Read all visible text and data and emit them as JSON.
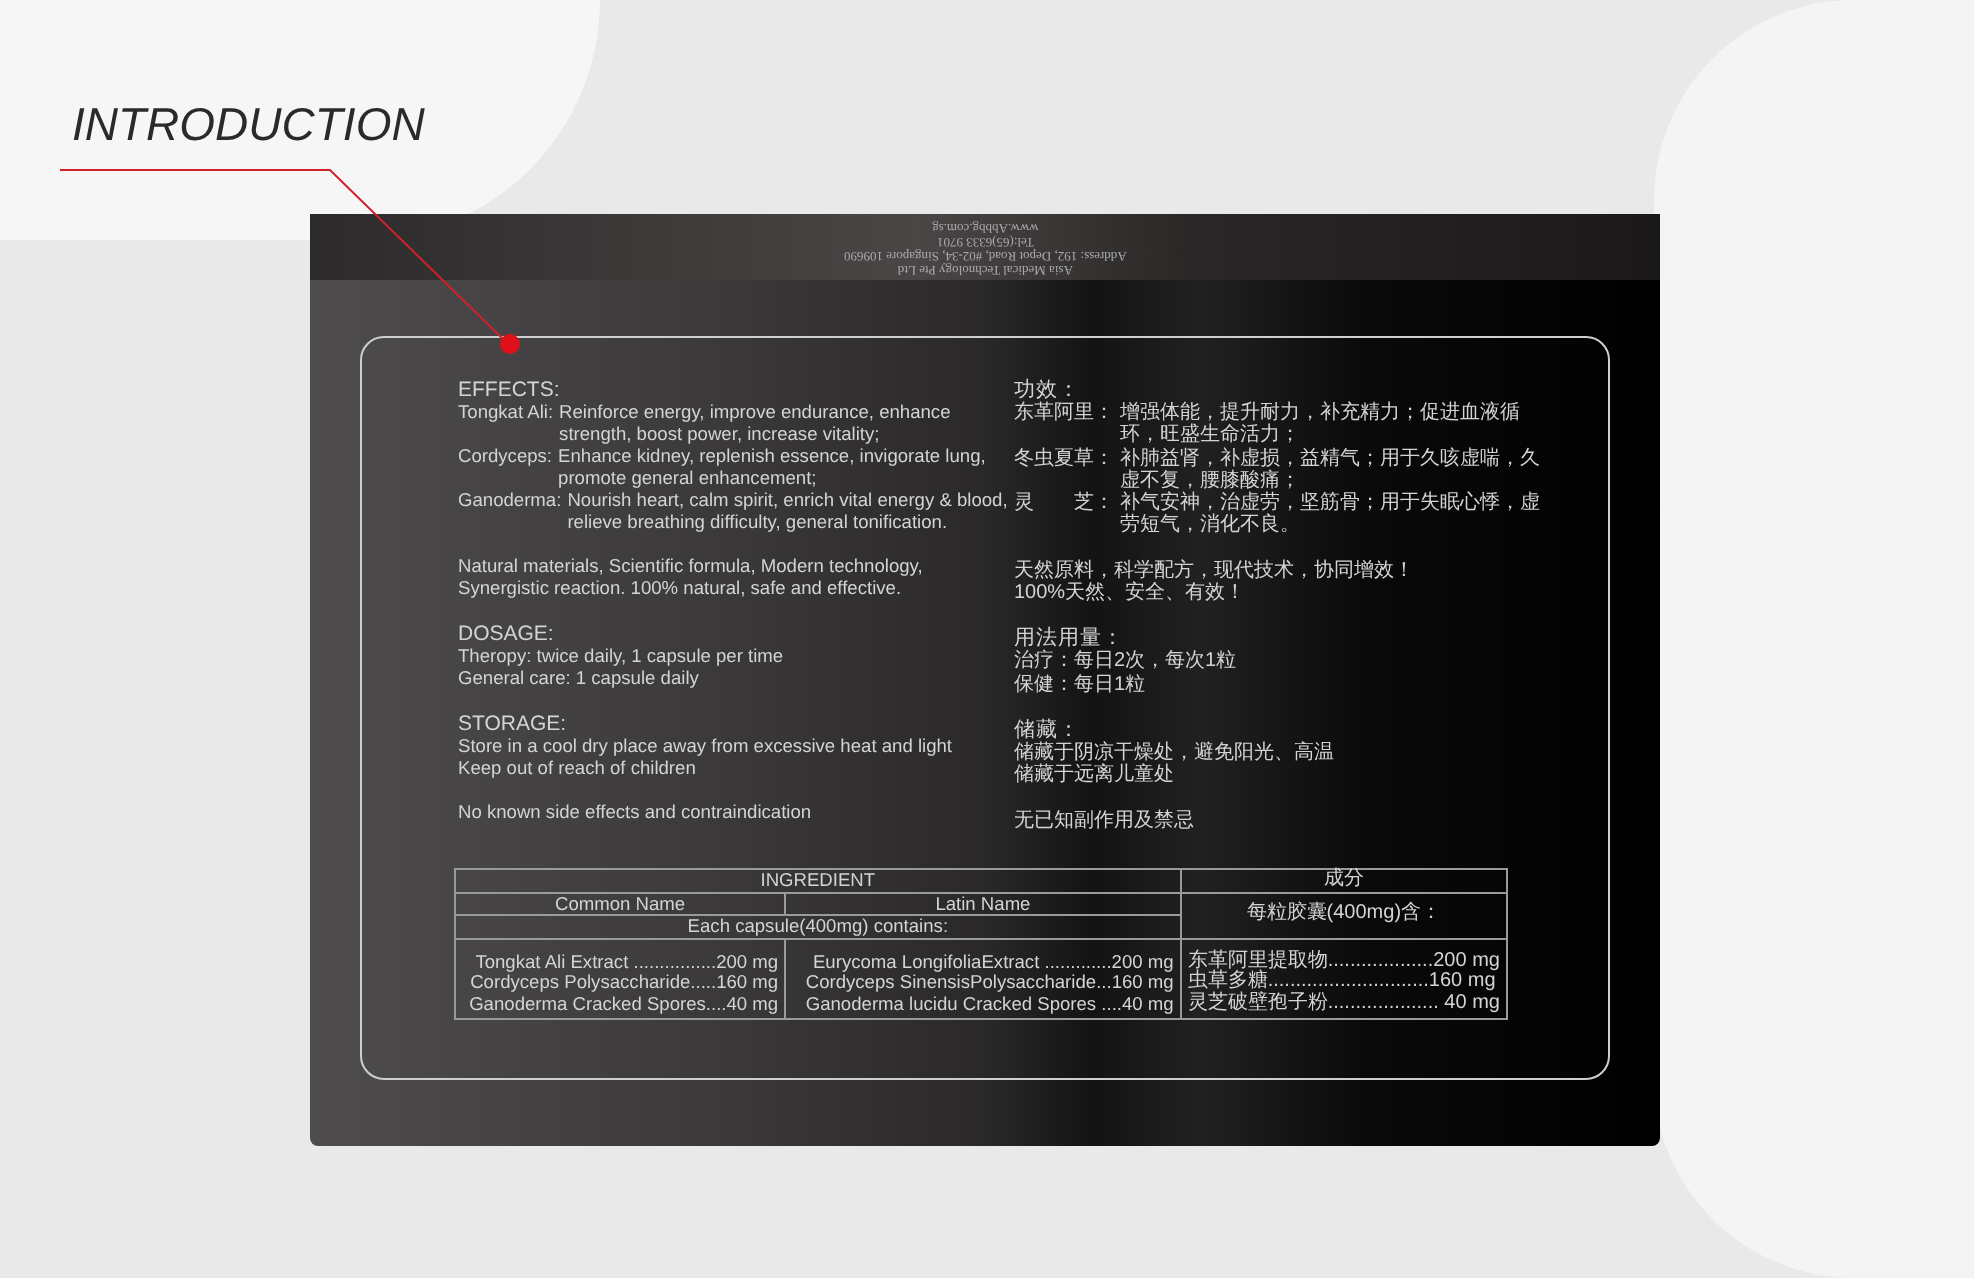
{
  "heading": "INTRODUCTION",
  "box_top_lines": [
    "Asia Medical Technology Pte Ltd",
    "Address: 192, Depot Road, #02-34, Singapore 109690",
    "Tel:(65)6333 9701",
    "www.Abbbg.com.sg"
  ],
  "english": [
    {
      "title": "EFFECTS:",
      "items": [
        {
          "label": "Tongkat Ali:",
          "text": "Reinforce energy, improve endurance, enhance strength, boost power, increase vitality;"
        },
        {
          "label": "Cordyceps:",
          "text": "Enhance kidney, replenish essence, invigorate lung, promote general enhancement;"
        },
        {
          "label": "Ganoderma:",
          "text": "Nourish heart, calm spirit, enrich vital energy & blood, relieve breathing difficulty, general tonification."
        }
      ]
    },
    {
      "lines": [
        "Natural materials, Scientific formula, Modern technology,",
        "Synergistic reaction. 100% natural, safe and effective."
      ]
    },
    {
      "title": "DOSAGE:",
      "lines": [
        "Theropy: twice daily, 1 capsule per time",
        "General care: 1 capsule daily"
      ]
    },
    {
      "title": "STORAGE:",
      "lines": [
        "Store in a cool dry place away from excessive heat and light",
        "Keep out of reach of children"
      ]
    },
    {
      "lines": [
        "No known side effects and contraindication"
      ]
    }
  ],
  "chinese": [
    {
      "title": "功效：",
      "items": [
        {
          "label": "东革阿里：",
          "text": "增强体能，提升耐力，补充精力；促进血液循环，旺盛生命活力；"
        },
        {
          "label": "冬虫夏草：",
          "text": "补肺益肾，补虚损，益精气；用于久咳虚喘，久虚不复，腰膝酸痛；"
        },
        {
          "label": "灵　　芝：",
          "text": "补气安神，治虚劳，坚筋骨；用于失眠心悸，虚劳短气，消化不良。"
        }
      ]
    },
    {
      "lines": [
        "天然原料，科学配方，现代技术，协同增效！",
        "100%天然、安全、有效！"
      ]
    },
    {
      "title": "用法用量：",
      "lines": [
        "治疗：每日2次，每次1粒",
        "保健：每日1粒"
      ]
    },
    {
      "title": "储藏：",
      "lines": [
        "储藏于阴凉干燥处，避免阳光、高温",
        "储藏于远离儿童处"
      ]
    },
    {
      "lines": [
        "无已知副作用及禁忌"
      ]
    }
  ],
  "table": {
    "title": "INGREDIENT",
    "title_cn": "成分",
    "common_name": "Common Name",
    "latin_name": "Latin Name",
    "contains": "Each capsule(400mg) contains:",
    "contains_cn": "每粒胶囊(400mg)含：",
    "common": [
      "Tongkat Ali Extract ................200 mg",
      "Cordyceps Polysaccharide.....160 mg",
      "Ganoderma Cracked Spores....40 mg"
    ],
    "latin": [
      "Eurycoma LongifoliaExtract .............200 mg",
      "Cordyceps SinensisPolysaccharide...160 mg",
      "Ganoderma lucidu Cracked Spores ....40 mg"
    ],
    "chinese": [
      "东革阿里提取物...................200 mg",
      "虫草多糖.............................160 mg",
      "灵芝破壁孢子粉.................... 40 mg"
    ]
  }
}
